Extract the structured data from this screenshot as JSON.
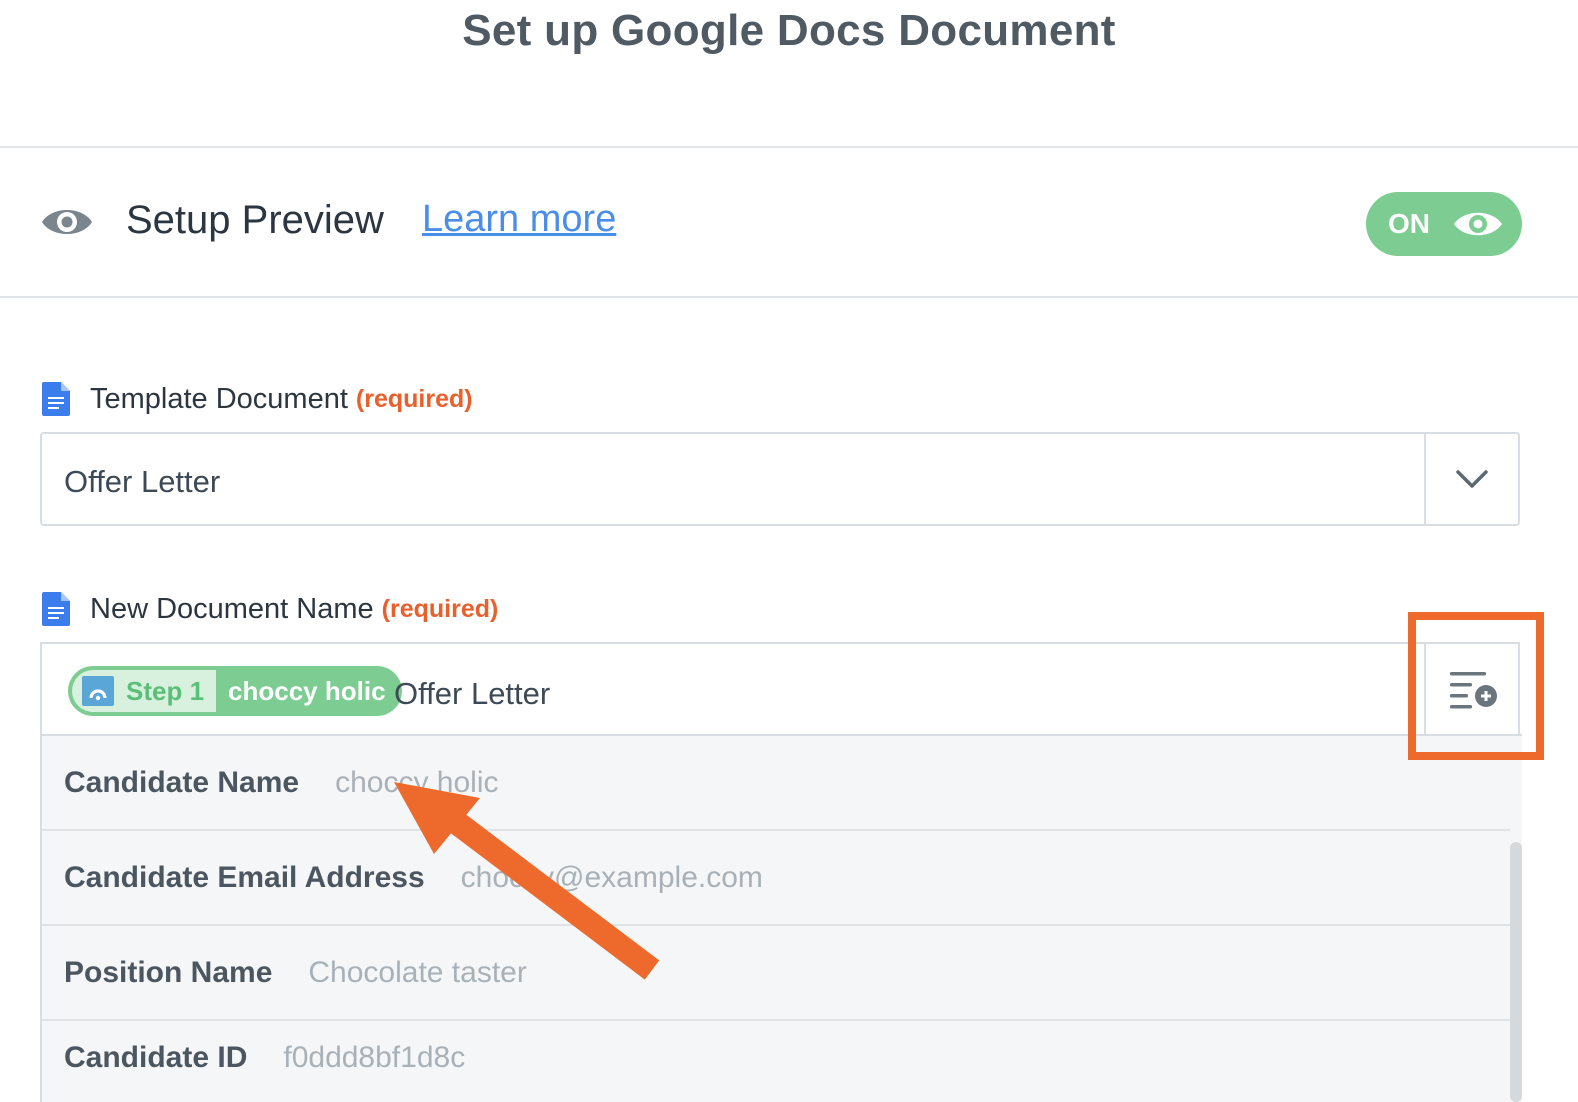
{
  "header": {
    "title": "Set up Google Docs Document"
  },
  "preview": {
    "title": "Setup Preview",
    "learn_more": "Learn more",
    "toggle_label": "ON",
    "toggle_state": "on"
  },
  "template_field": {
    "label": "Template Document",
    "required": "(required)",
    "value": "Offer Letter",
    "icon": "google-docs-icon"
  },
  "name_field": {
    "label": "New Document Name",
    "required": "(required)",
    "icon": "google-docs-icon",
    "token": {
      "step": "Step 1",
      "value": "choccy holic",
      "app_icon": "trigger-app-icon"
    },
    "text": "Offer Letter",
    "insert_icon": "insert-field-icon"
  },
  "dropdown": {
    "options": [
      {
        "label": "Candidate Name",
        "value": "choccy holic"
      },
      {
        "label": "Candidate Email Address",
        "value": "choccy@example.com"
      },
      {
        "label": "Position Name",
        "value": "Chocolate taster"
      },
      {
        "label": "Candidate ID",
        "value": "f0ddd8bf1d8c"
      }
    ]
  },
  "colors": {
    "accent_green": "#7dcd93",
    "link_blue": "#4a8ee8",
    "required_orange": "#e8602c",
    "annotation_orange": "#ee6a2c"
  }
}
